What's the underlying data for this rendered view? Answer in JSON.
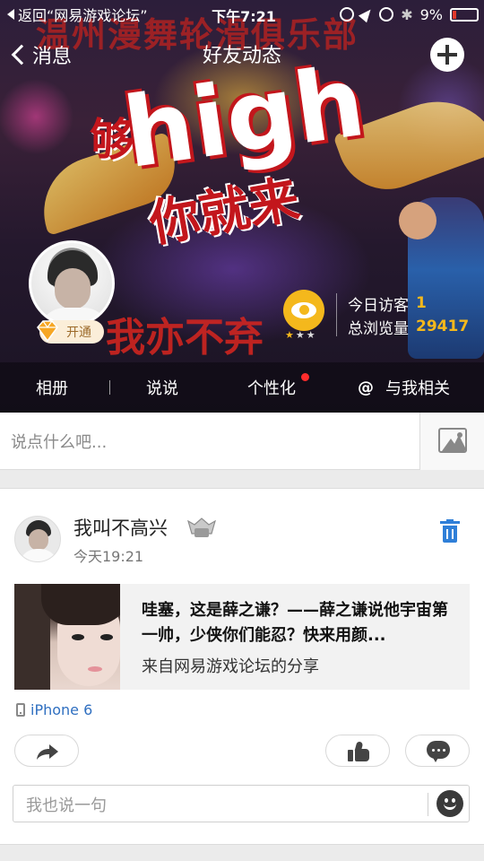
{
  "status_bar": {
    "back_app": "返回“网易游戏论坛”",
    "time": "下午7:21",
    "battery": "9%"
  },
  "nav": {
    "back_label": "消息",
    "title": "好友动态"
  },
  "cover": {
    "banner_text": "温州漫舞轮滑俱乐部",
    "headline_high": "high",
    "headline_prefix": "够",
    "headline_sub": "你就来",
    "slogan": "我亦不弃",
    "vip_label": "开通",
    "visitors_today_label": "今日访客",
    "visitors_today": "1",
    "total_views_label": "总浏览量",
    "total_views": "29417",
    "tabs": [
      {
        "label": "相册"
      },
      {
        "label": "说说"
      },
      {
        "label": "个性化"
      },
      {
        "label": "与我相关"
      }
    ]
  },
  "composer": {
    "placeholder": "说点什么吧..."
  },
  "post": {
    "author": "我叫不高兴",
    "time": "今天19:21",
    "share_title": "哇塞，这是薛之谦？——薛之谦说他宇宙第一帅，少侠你们能忍？快来用颜...",
    "share_source": "来自网易游戏论坛的分享",
    "device": "iPhone 6",
    "reply_placeholder": "我也说一句"
  },
  "colors": {
    "accent_blue": "#2f7fd8",
    "gold": "#f4b81c",
    "link_blue": "#2f6fc0"
  }
}
